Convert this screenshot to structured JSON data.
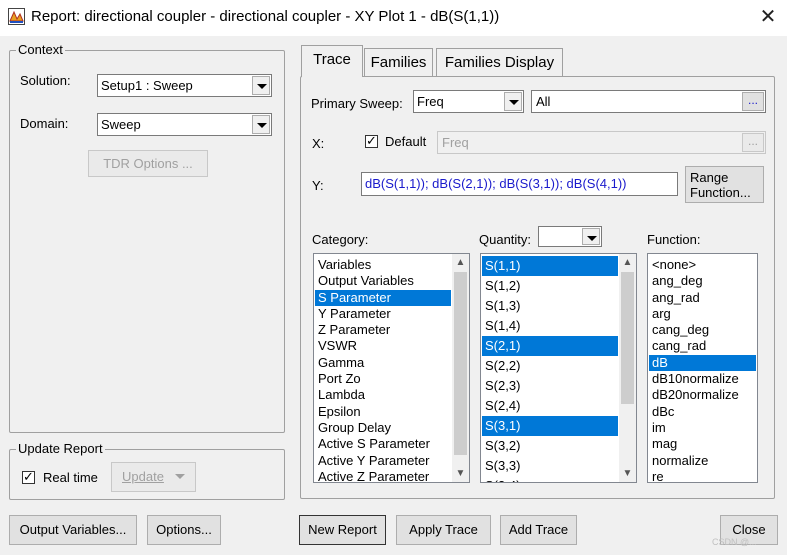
{
  "window": {
    "title": "Report: directional coupler - directional coupler - XY Plot 1 - dB(S(1,1))",
    "close_glyph": "✕"
  },
  "context": {
    "group_label": "Context",
    "solution_label": "Solution:",
    "solution_value": "Setup1 : Sweep",
    "domain_label": "Domain:",
    "domain_value": "Sweep",
    "tdr_button": "TDR Options ..."
  },
  "update_report": {
    "group_label": "Update Report",
    "realtime_label": "Real time",
    "realtime_checked": true,
    "update_button": "Update"
  },
  "tabs": [
    {
      "label": "Trace",
      "active": true
    },
    {
      "label": "Families",
      "active": false
    },
    {
      "label": "Families Display",
      "active": false
    }
  ],
  "trace": {
    "primary_sweep_label": "Primary Sweep:",
    "primary_sweep_value": "Freq",
    "sweep_range_value": "All",
    "ellipsis": "...",
    "x_label": "X:",
    "x_default_label": "Default",
    "x_default_checked": true,
    "x_value": "Freq",
    "y_label": "Y:",
    "y_value": "dB(S(1,1)); dB(S(2,1)); dB(S(3,1)); dB(S(4,1))",
    "range_function_line1": "Range",
    "range_function_line2": "Function...",
    "category_label": "Category:",
    "quantity_label": "Quantity:",
    "function_label": "Function:",
    "categories": [
      {
        "label": "Variables",
        "selected": false
      },
      {
        "label": "Output Variables",
        "selected": false
      },
      {
        "label": "S Parameter",
        "selected": true
      },
      {
        "label": "Y Parameter",
        "selected": false
      },
      {
        "label": "Z Parameter",
        "selected": false
      },
      {
        "label": "VSWR",
        "selected": false
      },
      {
        "label": "Gamma",
        "selected": false
      },
      {
        "label": "Port Zo",
        "selected": false
      },
      {
        "label": "Lambda",
        "selected": false
      },
      {
        "label": "Epsilon",
        "selected": false
      },
      {
        "label": "Group Delay",
        "selected": false
      },
      {
        "label": "Active S Parameter",
        "selected": false
      },
      {
        "label": "Active Y Parameter",
        "selected": false
      },
      {
        "label": "Active Z Parameter",
        "selected": false
      }
    ],
    "quantities": [
      {
        "label": "S(1,1)",
        "selected": true
      },
      {
        "label": "S(1,2)",
        "selected": false
      },
      {
        "label": "S(1,3)",
        "selected": false
      },
      {
        "label": "S(1,4)",
        "selected": false
      },
      {
        "label": "S(2,1)",
        "selected": true
      },
      {
        "label": "S(2,2)",
        "selected": false
      },
      {
        "label": "S(2,3)",
        "selected": false
      },
      {
        "label": "S(2,4)",
        "selected": false
      },
      {
        "label": "S(3,1)",
        "selected": true
      },
      {
        "label": "S(3,2)",
        "selected": false
      },
      {
        "label": "S(3,3)",
        "selected": false
      },
      {
        "label": "S(3,4)",
        "selected": false
      }
    ],
    "functions": [
      {
        "label": "<none>",
        "selected": false
      },
      {
        "label": "ang_deg",
        "selected": false
      },
      {
        "label": "ang_rad",
        "selected": false
      },
      {
        "label": "arg",
        "selected": false
      },
      {
        "label": "cang_deg",
        "selected": false
      },
      {
        "label": "cang_rad",
        "selected": false
      },
      {
        "label": "dB",
        "selected": true
      },
      {
        "label": "dB10normalize",
        "selected": false
      },
      {
        "label": "dB20normalize",
        "selected": false
      },
      {
        "label": "dBc",
        "selected": false
      },
      {
        "label": "im",
        "selected": false
      },
      {
        "label": "mag",
        "selected": false
      },
      {
        "label": "normalize",
        "selected": false
      },
      {
        "label": "re",
        "selected": false
      }
    ]
  },
  "footer": {
    "output_variables": "Output Variables...",
    "options": "Options...",
    "new_report": "New Report",
    "apply_trace": "Apply Trace",
    "add_trace": "Add Trace",
    "close": "Close",
    "watermark": "CSDN @..."
  },
  "colors": {
    "selection": "#0078d7",
    "y_text": "#1a1acc"
  }
}
